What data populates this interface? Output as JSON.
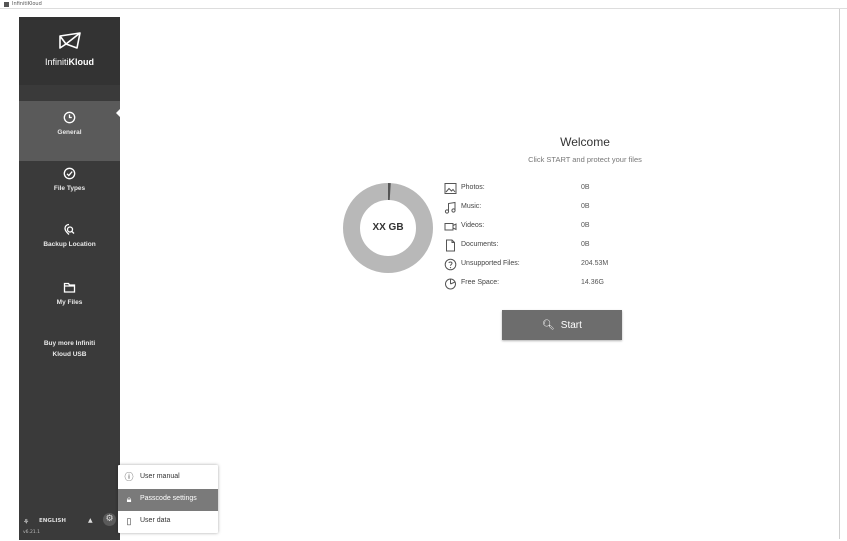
{
  "window": {
    "title": "InfinitiKloud"
  },
  "brand": {
    "prefix": "Infiniti",
    "suffix": "Kloud",
    "logo_icon": "kite-icon"
  },
  "sidebar": {
    "items": [
      {
        "label": "General",
        "icon": "clock-icon",
        "active": true
      },
      {
        "label": "File Types",
        "icon": "check-circle-icon",
        "active": false
      },
      {
        "label": "Backup Location",
        "icon": "location-search-icon",
        "active": false
      },
      {
        "label": "My Files",
        "icon": "folder-icon",
        "active": false
      }
    ],
    "buy_more_line1": "Buy more Infiniti",
    "buy_more_line2": "Kloud USB"
  },
  "footer": {
    "language": "ENGLISH",
    "language_caret": "▲",
    "version": "v6.21.1",
    "settings_icon": "gear-icon"
  },
  "settings_menu": {
    "items": [
      {
        "label": "User manual",
        "icon": "info-icon",
        "highlighted": false
      },
      {
        "label": "Passcode settings",
        "icon": "lock-icon",
        "highlighted": true
      },
      {
        "label": "User data",
        "icon": "document-icon",
        "highlighted": false
      }
    ]
  },
  "main": {
    "title": "Welcome",
    "subtitle": "Click START and protect your files",
    "donut_label": "XX GB",
    "used_fraction": 0.01,
    "stats": [
      {
        "label": "Photos:",
        "value": "0B",
        "icon": "photo-icon"
      },
      {
        "label": "Music:",
        "value": "0B",
        "icon": "music-icon"
      },
      {
        "label": "Videos:",
        "value": "0B",
        "icon": "video-icon"
      },
      {
        "label": "Documents:",
        "value": "0B",
        "icon": "document-icon"
      },
      {
        "label": "Unsupported Files:",
        "value": "204.53M",
        "icon": "question-icon"
      },
      {
        "label": "Free Space:",
        "value": "14.36G",
        "icon": "pie-icon"
      }
    ],
    "start_label": "Start",
    "start_icon": "search-icon"
  },
  "colors": {
    "sidebar": "#3a3a3a",
    "sidebar_active": "#5a5a5a",
    "button": "#6d6d6d",
    "donut_track": "#b8b8b8",
    "donut_used": "#555555"
  }
}
